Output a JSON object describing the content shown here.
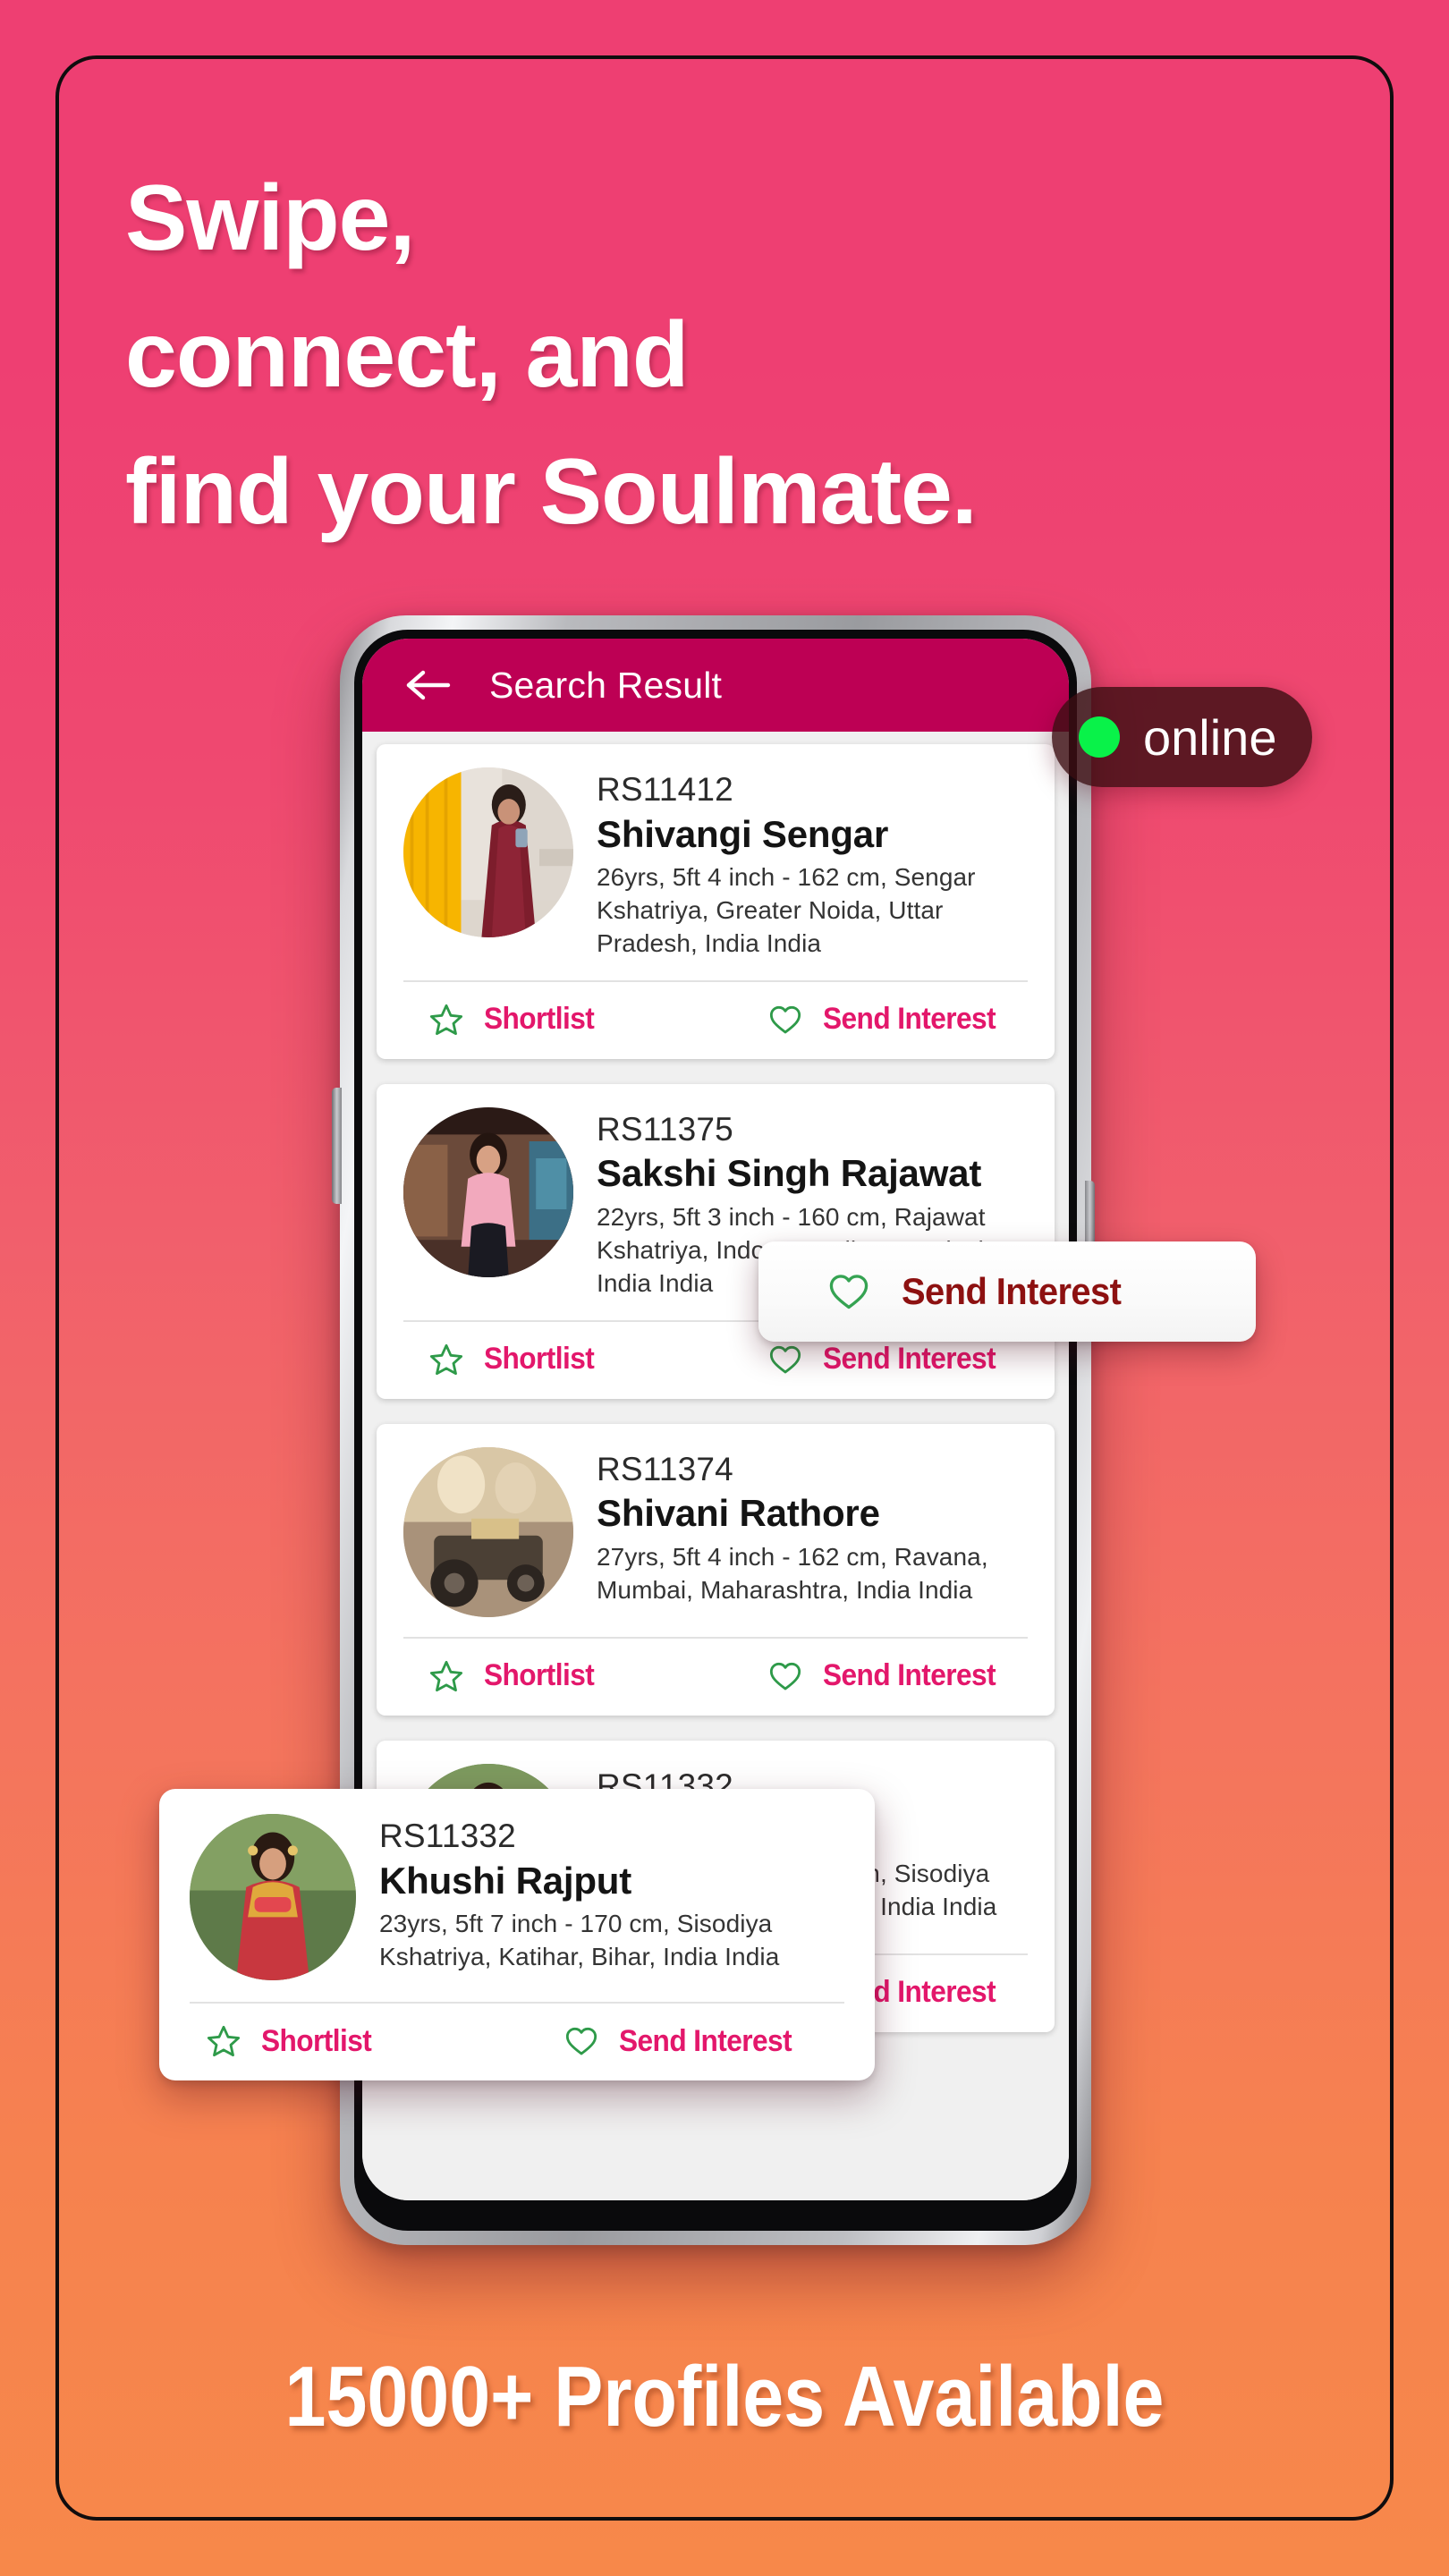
{
  "poster": {
    "headline_lines": [
      "Swipe,",
      "connect, and",
      "find your Soulmate."
    ],
    "bottom_headline": "15000+ Profiles Available",
    "brand_pink": "#ee3f72",
    "brand_orange": "#f7884a",
    "accent_pink": "#e3176b",
    "appbar_color": "#bd0054",
    "icon_green": "#2e9a49"
  },
  "online_badge": {
    "label": "online",
    "dot_color": "#09f249",
    "icon": "status-dot-icon"
  },
  "app": {
    "appbar": {
      "back_icon": "back-arrow-icon",
      "title": "Search Result"
    },
    "actions": {
      "shortlist_label": "Shortlist",
      "shortlist_icon": "star-outline-icon",
      "send_interest_label": "Send Interest",
      "send_interest_icon": "heart-outline-icon"
    },
    "profiles": [
      {
        "code": "RS11412",
        "name": "Shivangi Sengar",
        "details": "26yrs, 5ft 4 inch - 162 cm, Sengar Kshatriya, Greater Noida, Uttar Pradesh, India India",
        "avatar": "profile-photo-shivangi-sengar"
      },
      {
        "code": "RS11375",
        "name": "Sakshi Singh Rajawat",
        "details": "22yrs, 5ft 3 inch - 160 cm, Rajawat Kshatriya, Indore, Madhya Pradesh, India India",
        "avatar": "profile-photo-sakshi-singh-rajawat"
      },
      {
        "code": "RS11374",
        "name": "Shivani Rathore",
        "details": "27yrs, 5ft 4 inch - 162 cm, Ravana, Mumbai, Maharashtra, India India",
        "avatar": "profile-photo-shivani-rathore"
      },
      {
        "code": "RS11332",
        "name": "Khushi Rajput",
        "details": "23yrs, 5ft 7 inch - 170 cm, Sisodiya Kshatriya, Katihar, Bihar, India India",
        "avatar": "profile-photo-khushi-rajput"
      }
    ]
  },
  "float_send": {
    "label": "Send Interest",
    "icon": "heart-outline-icon"
  },
  "float_card": {
    "code": "RS11332",
    "name": "Khushi Rajput",
    "details": "23yrs, 5ft 7 inch - 170 cm, Sisodiya Kshatriya, Katihar, Bihar, India India",
    "avatar": "profile-photo-khushi-rajput",
    "shortlist_label": "Shortlist",
    "send_interest_label": "Send Interest"
  },
  "partial_card": {
    "details_line1": "Sisodiya",
    "details_line2": "dia India",
    "shortlist_label": "Shortlist",
    "send_interest_label": "Send Interest"
  }
}
